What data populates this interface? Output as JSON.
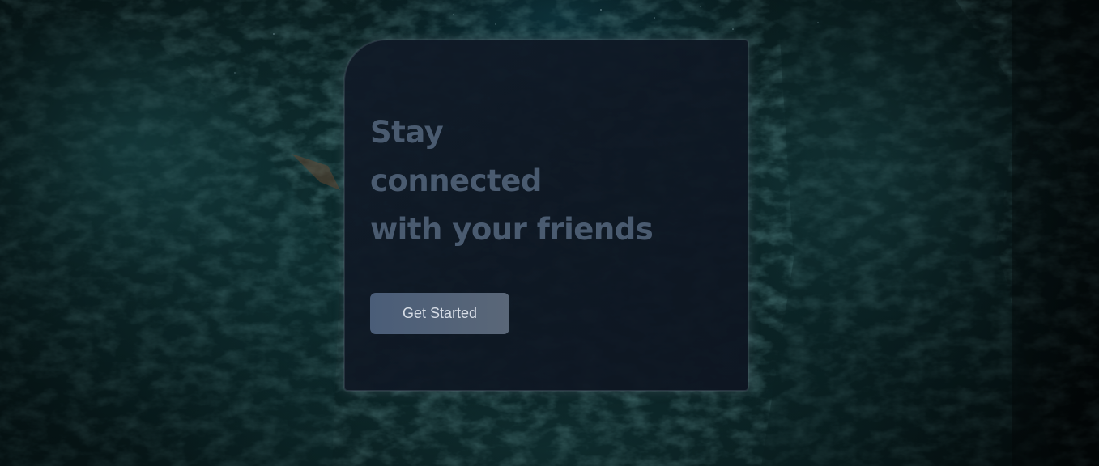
{
  "hero": {
    "headline_lines": [
      "Stay",
      "connected",
      "with your friends"
    ],
    "cta_label": "Get Started"
  },
  "colors": {
    "card_bg": "#111b28",
    "headline": "#4a5b70",
    "button_bg": "#4f6078",
    "button_text": "#d7dde6",
    "page_bg": "#06181a"
  },
  "icons": [
    "mountain-background-image"
  ]
}
